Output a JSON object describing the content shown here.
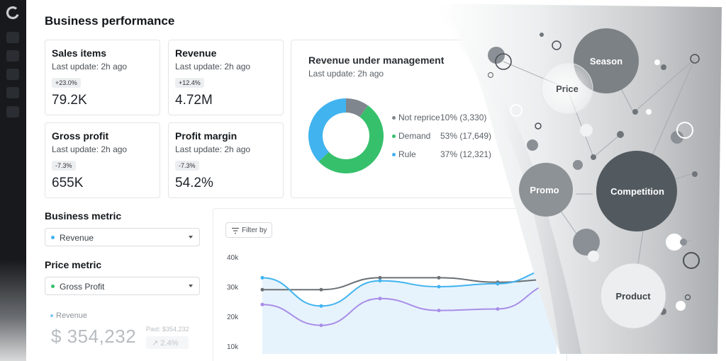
{
  "page": {
    "title": "Business performance"
  },
  "rail": {
    "items": [
      "nav-1",
      "nav-2",
      "nav-3",
      "nav-4",
      "nav-5",
      "nav-6"
    ]
  },
  "kpis": [
    {
      "title": "Sales items",
      "subtitle": "Last update: 2h ago",
      "change": "+23.0%",
      "value": "79.2K"
    },
    {
      "title": "Revenue",
      "subtitle": "Last update: 2h ago",
      "change": "+12.4%",
      "value": "4.72M"
    },
    {
      "title": "Gross profit",
      "subtitle": "Last update: 2h ago",
      "change": "-7.3%",
      "value": "655K"
    },
    {
      "title": "Profit margin",
      "subtitle": "Last update: 2h ago",
      "change": "-7.3%",
      "value": "54.2%"
    }
  ],
  "revenue_under_management": {
    "title": "Revenue under management",
    "subtitle": "Last update: 2h ago",
    "legend": [
      {
        "label": "Not reprice",
        "value": "10% (3,330)",
        "color": "#7f868d"
      },
      {
        "label": "Demand",
        "value": "53% (17,649)",
        "color": "#36c06b"
      },
      {
        "label": "Rule",
        "value": "37% (12,321)",
        "color": "#41b3ef"
      }
    ]
  },
  "business_metric": {
    "title": "Business metric",
    "selected": "Revenue",
    "color": "#41b3ef"
  },
  "price_metric": {
    "title": "Price metric",
    "selected": "Gross Profit",
    "color": "#36c06b"
  },
  "revenue_summary": {
    "label": "Revenue",
    "value": "$ 354,232",
    "past": "Past: $354,232",
    "delta": "↗ 2.4%"
  },
  "filter": {
    "label": "Filter by"
  },
  "bubbles": {
    "season": "Season",
    "price": "Price",
    "promo": "Promo",
    "competition": "Competition",
    "product": "Product"
  },
  "chart_data": [
    {
      "type": "pie",
      "title": "Revenue under management",
      "categories": [
        "Not reprice",
        "Demand",
        "Rule"
      ],
      "values": [
        10,
        53,
        37
      ],
      "colors": [
        "#7f868d",
        "#36c06b",
        "#41b3ef"
      ]
    },
    {
      "type": "line",
      "y_ticks": [
        "40k",
        "30k",
        "20k",
        "10k"
      ],
      "ylim": [
        10000,
        40000
      ],
      "grid": false,
      "series": [
        {
          "color": "#6b7075",
          "values": [
            29000,
            29000,
            33000,
            33000,
            31500,
            32500
          ]
        },
        {
          "color": "#41b3ef",
          "values": [
            33000,
            23500,
            32000,
            30000,
            31000,
            36000
          ]
        },
        {
          "color": "#a98de8",
          "values": [
            24000,
            17000,
            26000,
            22000,
            22500,
            31000
          ]
        }
      ]
    }
  ]
}
